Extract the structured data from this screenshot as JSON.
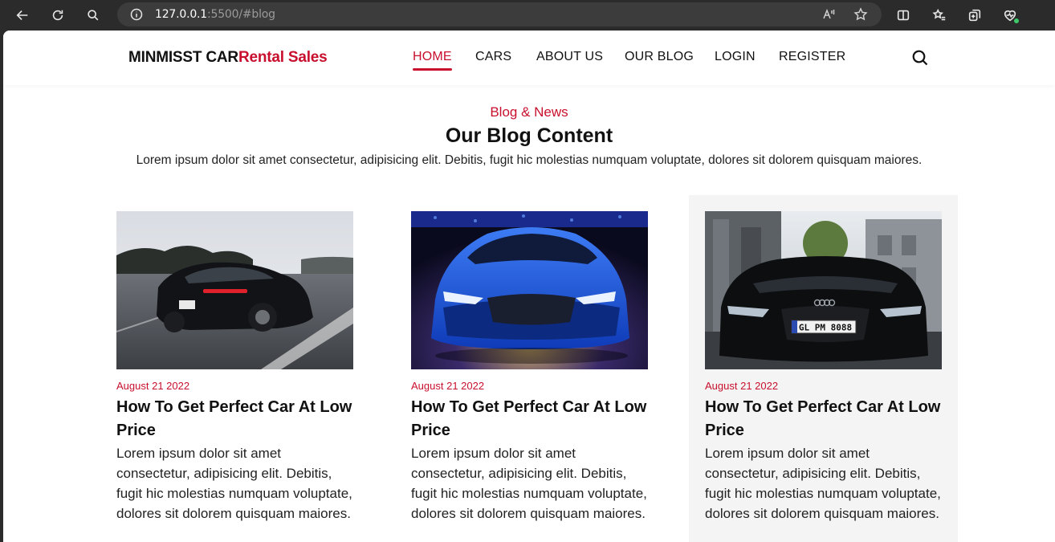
{
  "browser": {
    "url_host": "127.0.0.1",
    "url_rest": ":5500/#blog"
  },
  "header": {
    "logo_main": "MINMISST CAR",
    "logo_accent": "Rental Sales",
    "nav": [
      "HOME",
      "CARS",
      "ABOUT US",
      "OUR BLOG",
      "LOGIN",
      "REGISTER"
    ],
    "active_nav": "HOME"
  },
  "blog": {
    "subtitle": "Blog & News",
    "title": "Our Blog Content",
    "description": "Lorem ipsum dolor sit amet consectetur, adipisicing elit. Debitis, fugit hic molestias numquam voluptate, dolores sit dolorem quisquam maiores.",
    "posts": [
      {
        "date": "August 21 2022",
        "title": "How To Get Perfect Car At Low Price",
        "excerpt": "Lorem ipsum dolor sit amet consectetur, adipisicing elit. Debitis, fugit hic molestias numquam voluptate, dolores sit dolorem quisquam maiores."
      },
      {
        "date": "August 21 2022",
        "title": "How To Get Perfect Car At Low Price",
        "excerpt": "Lorem ipsum dolor sit amet consectetur, adipisicing elit. Debitis, fugit hic molestias numquam voluptate, dolores sit dolorem quisquam maiores."
      },
      {
        "date": "August 21 2022",
        "title": "How To Get Perfect Car At Low Price",
        "excerpt": "Lorem ipsum dolor sit amet consectetur, adipisicing elit. Debitis, fugit hic molestias numquam voluptate, dolores sit dolorem quisquam maiores."
      }
    ]
  },
  "colors": {
    "accent": "#c8102e",
    "text": "#111111",
    "card_highlight_bg": "#f4f4f4"
  },
  "icons": {
    "back": "back-arrow-icon",
    "reload": "reload-icon",
    "search": "search-icon",
    "info": "info-icon",
    "read_aloud": "read-aloud-icon",
    "favorite": "star-icon"
  }
}
